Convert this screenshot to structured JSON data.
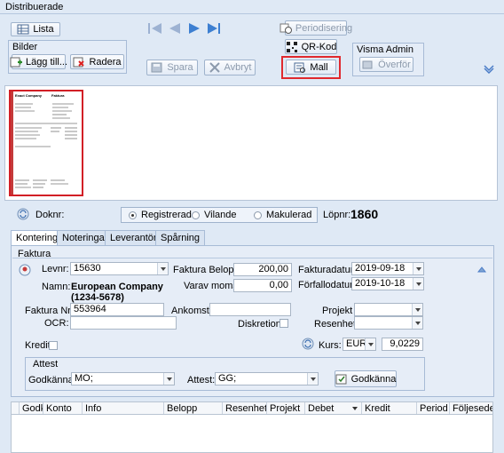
{
  "window": {
    "title": "Distribuerade"
  },
  "toolbar": {
    "lista": "Lista",
    "bilder_title": "Bilder",
    "lagg_till": "Lägg till...",
    "radera": "Radera",
    "spara": "Spara",
    "avbryt": "Avbryt",
    "periodisering": "Periodisering",
    "qr_kod": "QR-Kod",
    "mall": "Mall",
    "visma_title": "Visma Admin",
    "overfor": "Överför"
  },
  "document_bar": {
    "doknr_label": "Doknr:",
    "status_options": [
      "Registrerad",
      "Vilande",
      "Makulerad"
    ],
    "status_selected": "Registrerad",
    "lopnr_label": "Löpnr:",
    "lopnr_value": "1860"
  },
  "tabs": [
    "Kontering",
    "Noteringar",
    "Leverantör",
    "Spårning"
  ],
  "faktura": {
    "title": "Faktura",
    "levnr_label": "Levnr:",
    "levnr_value": "15630",
    "namn_label": "Namn:",
    "namn_value": "European Company",
    "namn_id": "(1234-5678)",
    "belopp_label": "Faktura Belopp:",
    "belopp_value": "200,00",
    "moms_label": "Varav moms:",
    "moms_value": "0,00",
    "fakturadatum_label": "Fakturadatum:",
    "fakturadatum_value": "2019-09-18",
    "forfallodatum_label": "Förfallodatum:",
    "forfallodatum_value": "2019-10-18",
    "fakturanr_label": "Faktura Nr:",
    "fakturanr_value": "553964",
    "ocr_label": "OCR:",
    "ocr_value": "",
    "ankomst_label": "Ankomst:",
    "ankomst_value": "",
    "diskretion_label": "Diskretion:",
    "projekt_label": "Projekt",
    "resenhet_label": "Resenhet",
    "kredit_label": "Kredit",
    "kurs_label": "Kurs:",
    "kurs_currency": "EUR",
    "kurs_value": "9,0229"
  },
  "attest": {
    "title": "Attest",
    "godkanna_label": "Godkänna:",
    "godkanna_value": "MO;",
    "attest_label": "Attest:",
    "attest_value": "GG;",
    "godkanna_button": "Godkänna"
  },
  "grid": {
    "columns": [
      "Godk",
      "Konto",
      "Info",
      "Belopp",
      "Resenhet",
      "Projekt",
      "Debet",
      "Kredit",
      "Period",
      "Följesedel"
    ]
  },
  "thumbnail": {
    "company": "Exact Company",
    "doc_label": "Faktura"
  }
}
